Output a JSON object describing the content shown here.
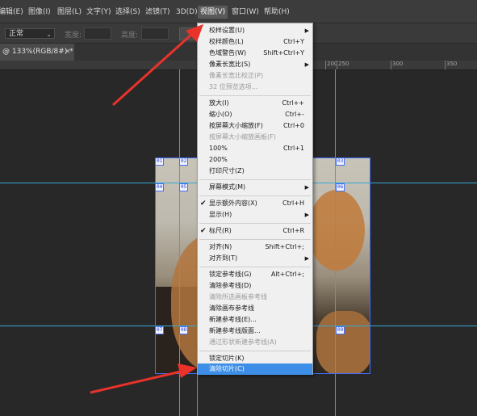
{
  "menubar": {
    "items": [
      "编辑(E)",
      "图像(I)",
      "图层(L)",
      "文字(Y)",
      "选择(S)",
      "滤镜(T)",
      "3D(D)",
      "视图(V)",
      "窗口(W)",
      "帮助(H)"
    ]
  },
  "options": {
    "style_value": "正常",
    "width_label": "宽度:",
    "height_label": "高度:"
  },
  "tab": {
    "title": "@ 133%(RGB/8#) *",
    "close": "×"
  },
  "ruler": {
    "labels": [
      "100",
      "150",
      "200",
      "250",
      "300",
      "350"
    ]
  },
  "slices": {
    "labels": [
      "01",
      "02",
      "03",
      "04",
      "05",
      "06",
      "07",
      "08",
      "09"
    ]
  },
  "view_menu": {
    "items": [
      {
        "label": "校样设置(U)",
        "shortcut": ""
      },
      {
        "label": "校样颜色(L)",
        "shortcut": "Ctrl+Y"
      },
      {
        "label": "色域警告(W)",
        "shortcut": "Shift+Ctrl+Y"
      },
      {
        "label": "像素长宽比(S)",
        "shortcut": ""
      },
      {
        "label": "像素长宽比校正(P)",
        "shortcut": ""
      },
      {
        "label": "32 位预览选项...",
        "shortcut": ""
      },
      {
        "label": "放大(I)",
        "shortcut": "Ctrl++"
      },
      {
        "label": "缩小(O)",
        "shortcut": "Ctrl+-"
      },
      {
        "label": "按屏幕大小缩放(F)",
        "shortcut": "Ctrl+0"
      },
      {
        "label": "按屏幕大小缩放画板(F)",
        "shortcut": ""
      },
      {
        "label": "100%",
        "shortcut": "Ctrl+1"
      },
      {
        "label": "200%",
        "shortcut": ""
      },
      {
        "label": "打印尺寸(Z)",
        "shortcut": ""
      },
      {
        "label": "屏幕模式(M)",
        "shortcut": ""
      },
      {
        "label": "显示额外内容(X)",
        "shortcut": "Ctrl+H"
      },
      {
        "label": "显示(H)",
        "shortcut": ""
      },
      {
        "label": "标尺(R)",
        "shortcut": "Ctrl+R"
      },
      {
        "label": "对齐(N)",
        "shortcut": "Shift+Ctrl+;"
      },
      {
        "label": "对齐到(T)",
        "shortcut": ""
      },
      {
        "label": "锁定参考线(G)",
        "shortcut": "Alt+Ctrl+;"
      },
      {
        "label": "清除参考线(D)",
        "shortcut": ""
      },
      {
        "label": "清除所选画板参考线",
        "shortcut": ""
      },
      {
        "label": "清除画布参考线",
        "shortcut": ""
      },
      {
        "label": "新建参考线(E)...",
        "shortcut": ""
      },
      {
        "label": "新建参考线版面...",
        "shortcut": ""
      },
      {
        "label": "通过形状新建参考线(A)",
        "shortcut": ""
      },
      {
        "label": "锁定切片(K)",
        "shortcut": ""
      },
      {
        "label": "清除切片(C)",
        "shortcut": ""
      }
    ],
    "checkmark": "✔",
    "submenu_arrow": "▶"
  },
  "colors": {
    "accent": "#3d8ee6",
    "guide": "#34a7d6",
    "slice": "#3f6fff",
    "annotation_arrow": "#e8322a"
  }
}
